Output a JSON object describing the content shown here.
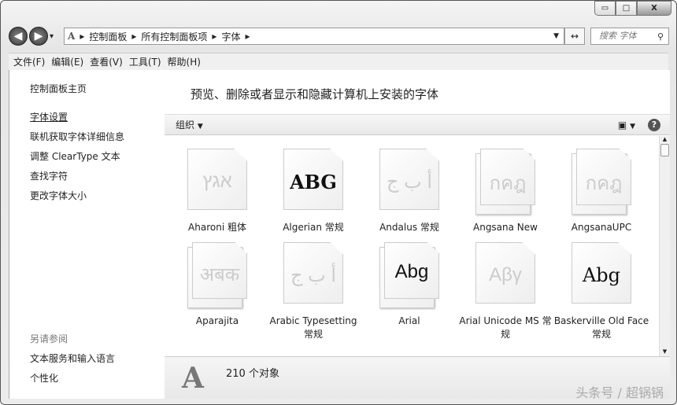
{
  "window": {
    "minimize": "▭",
    "maximize": "□",
    "close": "X"
  },
  "nav": {
    "back": "◀",
    "forward": "▶",
    "history": "▾"
  },
  "breadcrumb": [
    "控制面板",
    "所有控制面板项",
    "字体"
  ],
  "search": {
    "placeholder": "搜索 字体"
  },
  "menu": [
    "文件(F)",
    "编辑(E)",
    "查看(V)",
    "工具(T)",
    "帮助(H)"
  ],
  "sidebar": {
    "items": [
      "控制面板主页",
      "字体设置",
      "联机获取字体详细信息",
      "调整 ClearType 文本",
      "查找字符",
      "更改字体大小"
    ],
    "see_also_title": "另请参阅",
    "see_also": [
      "文本服务和输入语言",
      "个性化"
    ]
  },
  "header": "预览、删除或者显示和隐藏计算机上安装的字体",
  "toolbar": {
    "organize": "组织"
  },
  "fonts": [
    {
      "name": "Aharoni 粗体",
      "sample": "אגץ",
      "hidden": true,
      "family": false
    },
    {
      "name": "Algerian 常规",
      "sample": "ABG",
      "hidden": false,
      "family": false
    },
    {
      "name": "Andalus 常规",
      "sample": "أ ب ج",
      "hidden": true,
      "family": false
    },
    {
      "name": "Angsana New",
      "sample": "กคฎ",
      "hidden": true,
      "family": true
    },
    {
      "name": "AngsanaUPC",
      "sample": "กคฎ",
      "hidden": true,
      "family": true
    },
    {
      "name": "Aparajita",
      "sample": "अबक",
      "hidden": true,
      "family": true
    },
    {
      "name": "Arabic Typesetting 常规",
      "sample": "أ ب ج",
      "hidden": true,
      "family": false
    },
    {
      "name": "Arial",
      "sample": "Abg",
      "hidden": false,
      "family": true
    },
    {
      "name": "Arial Unicode MS 常规",
      "sample": "Aβγ",
      "hidden": true,
      "family": false
    },
    {
      "name": "Baskerville Old Face 常规",
      "sample": "Abg",
      "hidden": false,
      "family": false
    }
  ],
  "status": {
    "count": "210 个对象"
  },
  "watermark": "头条号 / 超锅锅"
}
